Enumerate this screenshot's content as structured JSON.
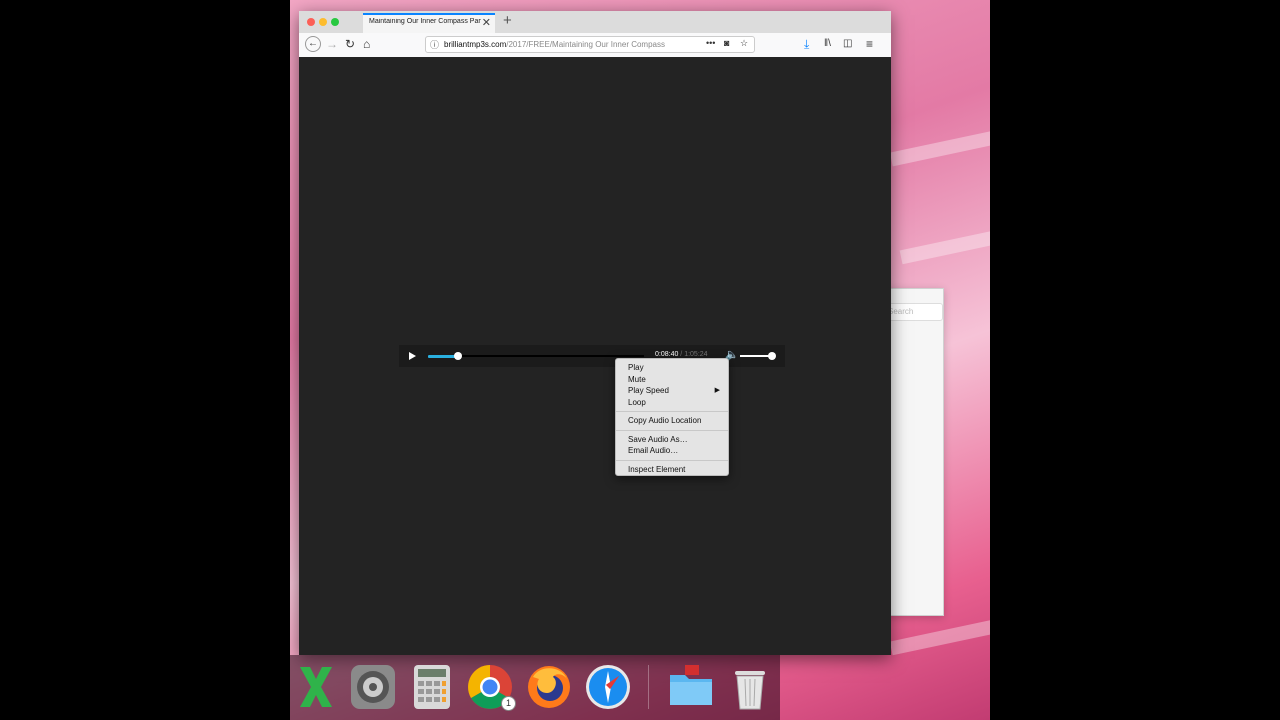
{
  "browser": {
    "tab_title": "Maintaining Our Inner Compass Part",
    "tab_close": "✕",
    "new_tab": "+",
    "url_host": "brilliantmp3s.com",
    "url_path": "/2017/FREE/Maintaining Our Inner Compass",
    "url_more": "•••"
  },
  "player": {
    "current_time": "0:08:40",
    "separator": " / ",
    "duration": "1:05:24",
    "progress": 0.14,
    "volume": 1.0
  },
  "context_menu": {
    "groups": [
      [
        {
          "label": "Play",
          "submenu": false
        },
        {
          "label": "Mute",
          "submenu": false
        },
        {
          "label": "Play Speed",
          "submenu": true
        },
        {
          "label": "Loop",
          "submenu": false
        }
      ],
      [
        {
          "label": "Copy Audio Location",
          "submenu": false
        }
      ],
      [
        {
          "label": "Save Audio As…",
          "submenu": false
        },
        {
          "label": "Email Audio…",
          "submenu": false
        }
      ],
      [
        {
          "label": "Inspect Element",
          "submenu": false
        }
      ]
    ],
    "submenu_arrow": "▶"
  },
  "bg_window": {
    "search_placeholder": "Search"
  },
  "dock": {
    "badge_chrome": "1",
    "items": [
      "excel-icon",
      "system-preferences-icon",
      "calculator-icon",
      "chrome-icon",
      "firefox-icon",
      "safari-icon",
      "folder-icon",
      "trash-icon"
    ]
  },
  "colors": {
    "accent": "#2ab0e0",
    "tab_accent": "#0a84ff"
  }
}
